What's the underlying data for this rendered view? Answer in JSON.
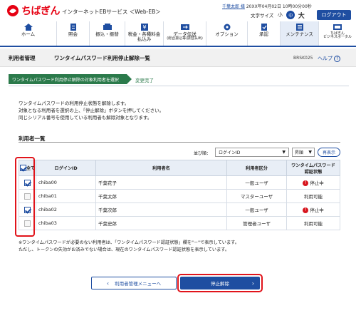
{
  "header": {
    "bank_name": "ちばぎん",
    "service_name": "インターネットEBサービス ＜Web-EB＞",
    "user_name": "千葉太郎 様",
    "last_login": "20XX年04月02日 10時00分00秒",
    "font_size_label": "文字サイズ",
    "font_size_small": "小",
    "font_size_medium": "中",
    "font_size_large": "大",
    "logout_label": "ログアウト"
  },
  "nav": {
    "items": [
      {
        "label": "ホーム"
      },
      {
        "label": "照会"
      },
      {
        "label": "振込・振替"
      },
      {
        "label": "税金・各種料金",
        "label2": "払込み"
      },
      {
        "label": "データ伝送",
        "label2": "(総合振込等/振替払出)"
      },
      {
        "label": "オプション"
      },
      {
        "label": "承認"
      },
      {
        "label": "メンテナンス"
      },
      {
        "label": "ちばぎん",
        "label2": "ビジネスポータル"
      }
    ]
  },
  "title_bar": {
    "breadcrumb": "利用者管理",
    "page_title": "ワンタイムパスワード利用停止解除一覧",
    "screen_id": "BRSK025",
    "help_label": "ヘルプ"
  },
  "steps": {
    "step1": "ワンタイムパスワード利用停止解除の対象利用者を選択",
    "step2": "変更完了"
  },
  "instructions": {
    "line1": "ワンタイムパスワードの利用停止状態を解除します。",
    "line2": "対象となる利用者を選択の上、「停止解除」ボタンを押してください。",
    "line3": "同じシリアル番号を使用している利用者も解除対象となります。"
  },
  "list": {
    "title": "利用者一覧",
    "sort_label": "並び順：",
    "sort_value": "ログインID",
    "order_value": "昇順",
    "resort_label": "再表示",
    "headers": {
      "all": "全て",
      "login_id": "ログインID",
      "user_name": "利用者名",
      "category": "利用者区分",
      "status_line1": "ワンタイムパスワード",
      "status_line2": "認証状態"
    },
    "rows": [
      {
        "checked": true,
        "login_id": "chiba00",
        "name": "千葉花子",
        "category": "一般ユーザ",
        "status": "停止中",
        "stopped": true
      },
      {
        "checked": false,
        "login_id": "chiba01",
        "name": "千葉太郎",
        "category": "マスターユーザ",
        "status": "利用可能",
        "stopped": false
      },
      {
        "checked": true,
        "login_id": "chiba02",
        "name": "千葉次郎",
        "category": "一般ユーザ",
        "status": "停止中",
        "stopped": true
      },
      {
        "checked": false,
        "login_id": "chiba03",
        "name": "千葉史郎",
        "category": "管理者ユーザ",
        "status": "利用可能",
        "stopped": false
      }
    ]
  },
  "note": {
    "line1": "※ワンタイムパスワードが必要のない利用者は、「ワンタイムパスワード認証状態」欄を\"－\"で表示しています。",
    "line2": "ただし、トークンの失効がお済みでない場合は、現在のワンタイムパスワード認証状態を表示しています。"
  },
  "buttons": {
    "back_label": "利用者管理メニューへ",
    "exec_label": "停止解除"
  },
  "colors": {
    "brand_red": "#e60012",
    "primary_blue": "#1f4ea1",
    "step_green": "#2b7a4b",
    "highlight_red": "#e1141b"
  }
}
